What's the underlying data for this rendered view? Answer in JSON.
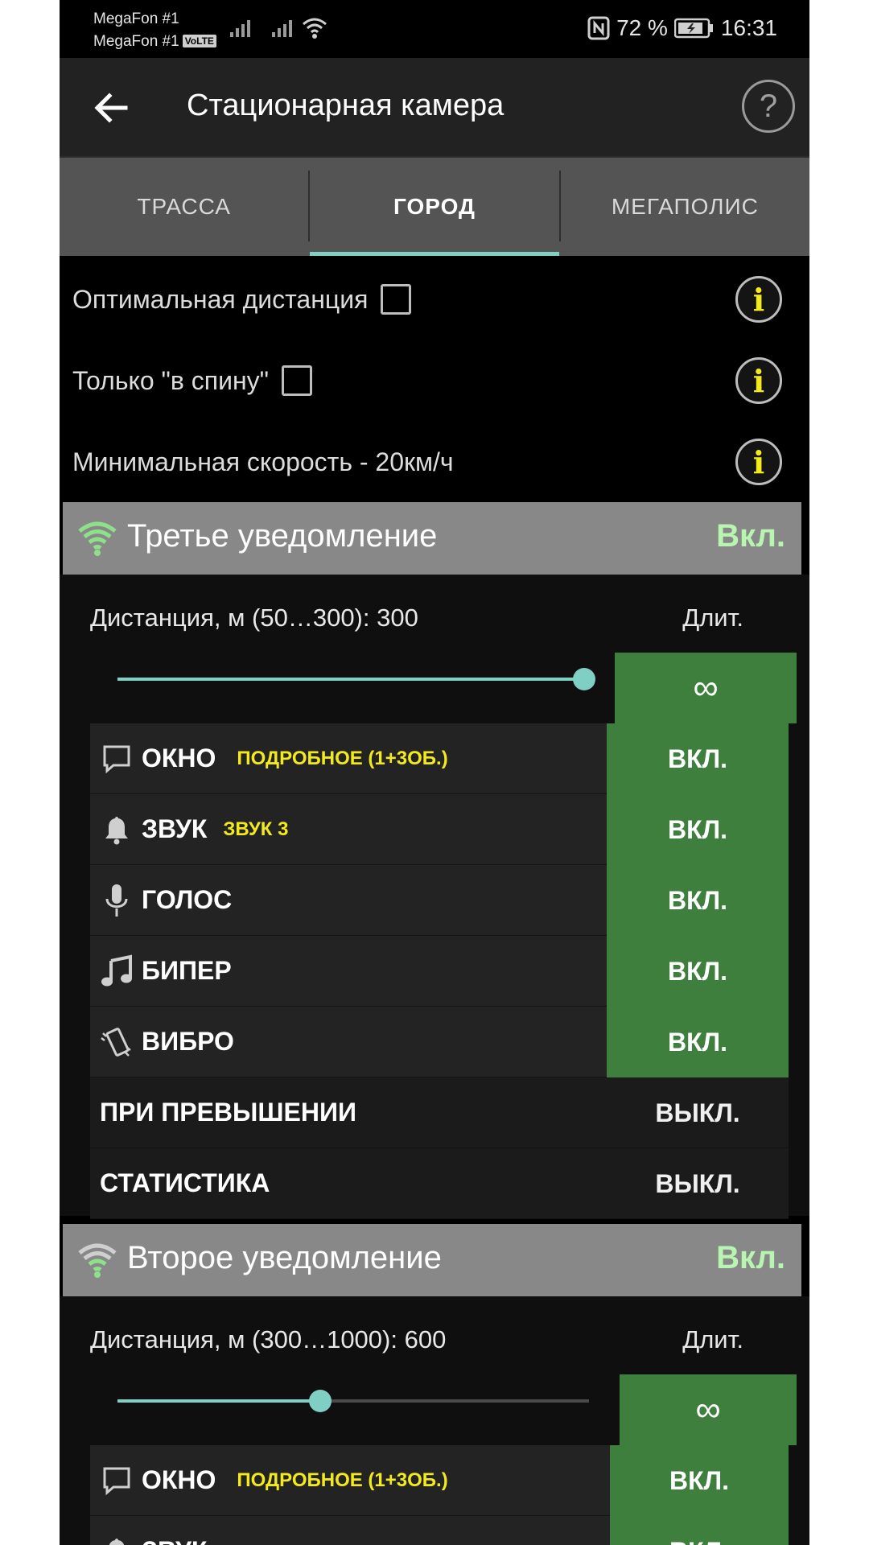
{
  "status_bar": {
    "carrier1": "MegaFon #1",
    "carrier2": "MegaFon #1",
    "volte": "VoLTE",
    "battery": "72 %",
    "time": "16:31"
  },
  "app_bar": {
    "title": "Стационарная камера",
    "help_label": "?"
  },
  "tabs": [
    {
      "label": "ТРАССА",
      "active": false
    },
    {
      "label": "ГОРОД",
      "active": true
    },
    {
      "label": "МЕГАПОЛИС",
      "active": false
    }
  ],
  "settings": [
    {
      "label": "Оптимальная дистанция",
      "checkbox": true,
      "checked": false
    },
    {
      "label": "Только \"в спину\"",
      "checkbox": true,
      "checked": false
    },
    {
      "label": "Минимальная скорость - 20км/ч",
      "checkbox": false
    }
  ],
  "info_glyph": "i",
  "sections": [
    {
      "title": "Третье уведомление",
      "state": "Вкл.",
      "distance_label": "Дистанция, м (50…300): 300",
      "duration_label": "Длит.",
      "duration_value": "∞",
      "slider_level": 1.0,
      "rows": [
        {
          "icon": "message-icon",
          "label": "ОКНО",
          "sub": "ПОДРОБНОЕ (1+3ОБ.)",
          "value": "ВКЛ.",
          "on": true
        },
        {
          "icon": "bell-icon",
          "label": "ЗВУК",
          "sub": "ЗВУК 3",
          "value": "ВКЛ.",
          "on": true
        },
        {
          "icon": "microphone-icon",
          "label": "ГОЛОС",
          "sub": "",
          "value": "ВКЛ.",
          "on": true
        },
        {
          "icon": "music-note-icon",
          "label": "БИПЕР",
          "sub": "",
          "value": "ВКЛ.",
          "on": true
        },
        {
          "icon": "vibrate-icon",
          "label": "ВИБРО",
          "sub": "",
          "value": "ВКЛ.",
          "on": true
        },
        {
          "icon": "",
          "label": "ПРИ ПРЕВЫШЕНИИ",
          "sub": "",
          "value": "ВЫКЛ.",
          "on": false
        },
        {
          "icon": "",
          "label": "СТАТИСТИКА",
          "sub": "",
          "value": "ВЫКЛ.",
          "on": false
        }
      ]
    },
    {
      "title": "Второе уведомление",
      "state": "Вкл.",
      "distance_label": "Дистанция, м (300…1000): 600",
      "duration_label": "Длит.",
      "duration_value": "∞",
      "slider_level": 0.43,
      "rows": [
        {
          "icon": "message-icon",
          "label": "ОКНО",
          "sub": "ПОДРОБНОЕ (1+3ОБ.)",
          "value": "ВКЛ.",
          "on": true
        },
        {
          "icon": "bell-icon",
          "label": "ЗВУК",
          "sub": "",
          "value": "ВКЛ.",
          "on": true
        }
      ]
    }
  ],
  "colors": {
    "accent": "#7fcfc4",
    "on_green": "#3e7f3e",
    "state_green": "#b8f5b0",
    "info_yellow": "#f2ea1c",
    "sub_yellow": "#f2ea1c"
  }
}
